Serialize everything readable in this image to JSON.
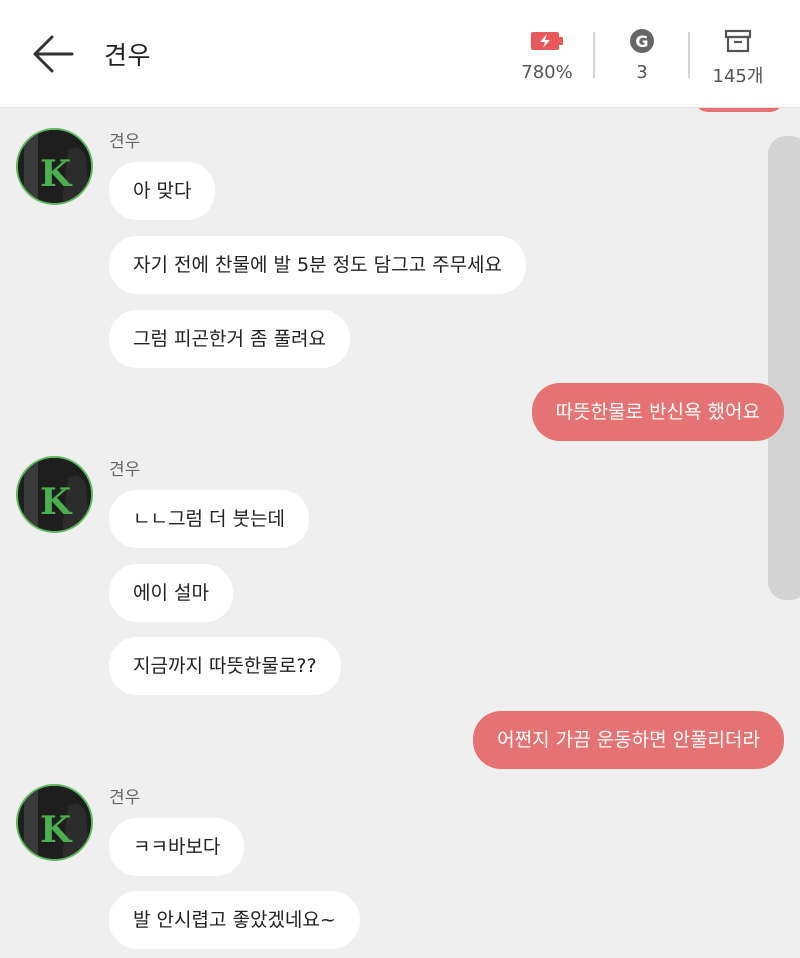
{
  "header": {
    "back_icon": "arrow-left-icon",
    "title": "견우",
    "stats": {
      "battery": {
        "icon": "battery-bolt-icon",
        "value": "780%"
      },
      "g": {
        "icon": "g-coin-icon",
        "value": "3"
      },
      "box": {
        "icon": "archive-box-icon",
        "value": "145개"
      }
    }
  },
  "colors": {
    "outgoing_bubble": "#e57373",
    "incoming_bubble": "#ffffff",
    "background": "#efefef",
    "avatar_border": "#5cb85c",
    "avatar_letter": "#4caf50"
  },
  "avatar_letter": "K",
  "messages": [
    {
      "dir": "in",
      "sender": "견우",
      "text": "아 맞다"
    },
    {
      "dir": "in",
      "text": "자기 전에 찬물에 발 5분 정도 담그고 주무세요"
    },
    {
      "dir": "in",
      "text": "그럼 피곤한거 좀 풀려요"
    },
    {
      "dir": "out",
      "text": "따뜻한물로 반신욕 했어요"
    },
    {
      "dir": "in",
      "sender": "견우",
      "text": "ㄴㄴ그럼 더 붓는데"
    },
    {
      "dir": "in",
      "text": "에이 설마"
    },
    {
      "dir": "in",
      "text": "지금까지 따뜻한물로??"
    },
    {
      "dir": "out",
      "text": "어쩐지 가끔 운동하면 안풀리더라"
    },
    {
      "dir": "in",
      "sender": "견우",
      "text": "ㅋㅋ바보다"
    },
    {
      "dir": "in",
      "text": "발 안시렵고 좋았겠네요~"
    }
  ]
}
